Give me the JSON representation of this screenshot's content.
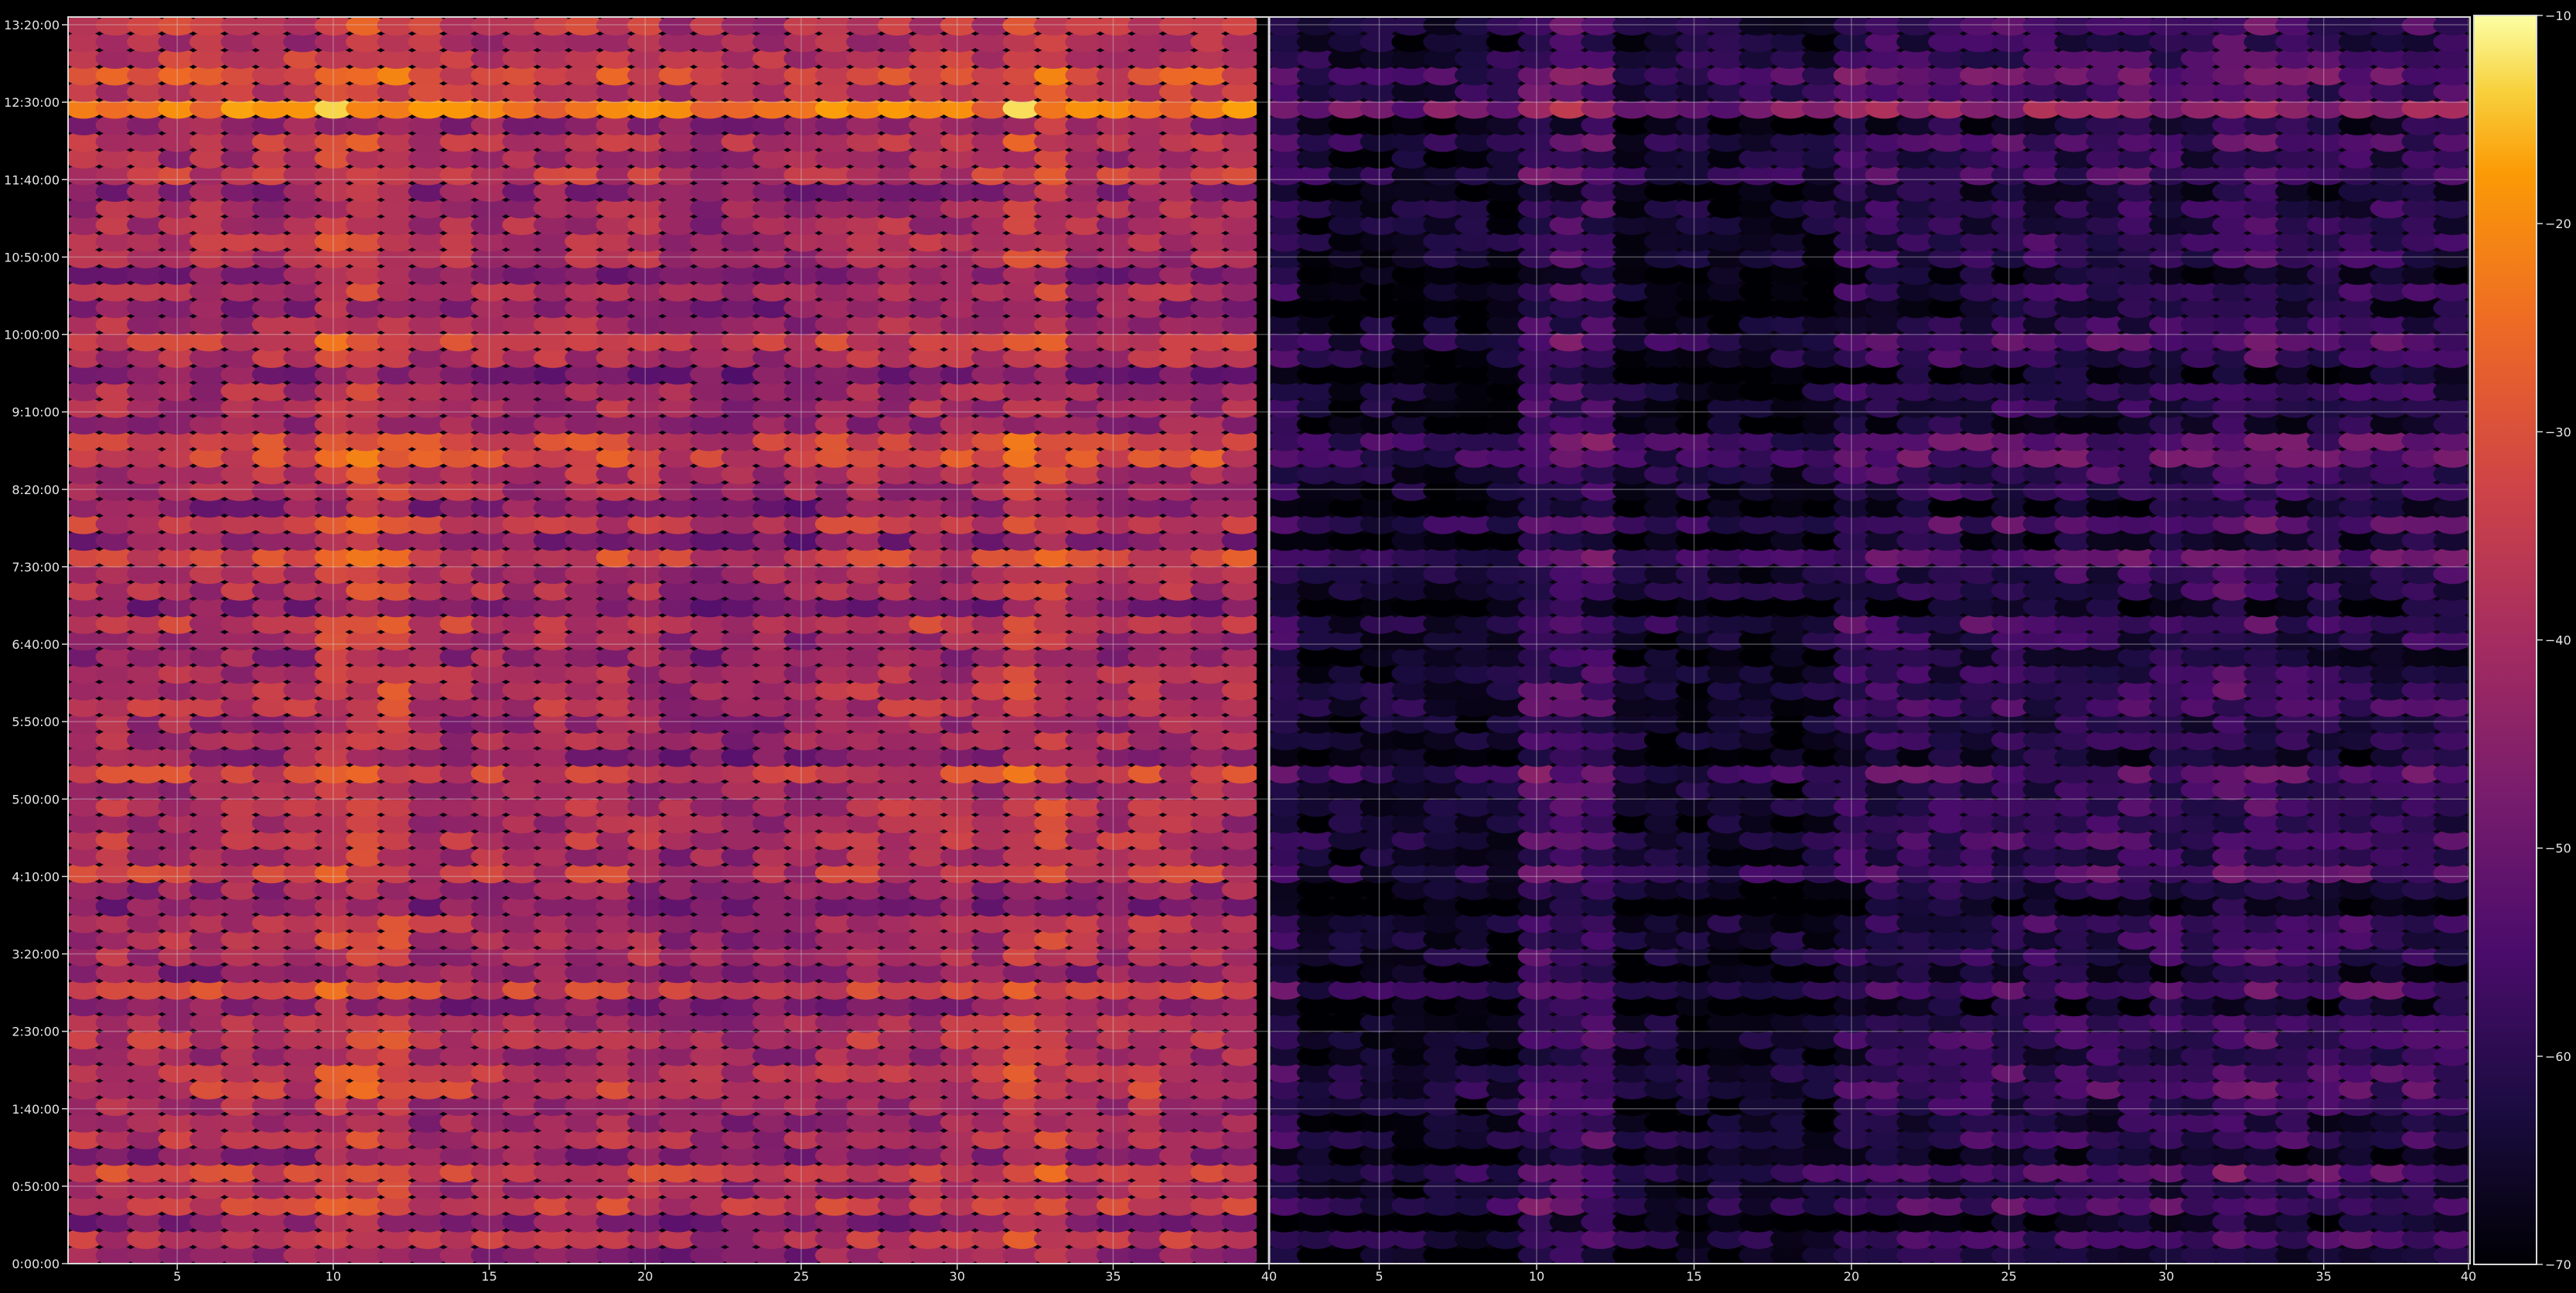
{
  "chart_data": {
    "type": "heatmap",
    "colormap": "inferno",
    "background": "#000000",
    "grid": true,
    "legend": "colorbar-right",
    "colorbar": {
      "range": [
        -70,
        -10
      ],
      "ticks": [
        {
          "value": -10,
          "label": "−10"
        },
        {
          "value": -20,
          "label": "−20"
        },
        {
          "value": -30,
          "label": "−30"
        },
        {
          "value": -40,
          "label": "−40"
        },
        {
          "value": -50,
          "label": "−50"
        },
        {
          "value": -60,
          "label": "−60"
        },
        {
          "value": -70,
          "label": "−70"
        }
      ]
    },
    "y_axis": {
      "range_minutes": [
        0,
        805
      ],
      "ticks": [
        {
          "value": 0,
          "label": "0:00:00"
        },
        {
          "value": 50,
          "label": "0:50:00"
        },
        {
          "value": 100,
          "label": "1:40:00"
        },
        {
          "value": 150,
          "label": "2:30:00"
        },
        {
          "value": 200,
          "label": "3:20:00"
        },
        {
          "value": 250,
          "label": "4:10:00"
        },
        {
          "value": 300,
          "label": "5:00:00"
        },
        {
          "value": 350,
          "label": "5:50:00"
        },
        {
          "value": 400,
          "label": "6:40:00"
        },
        {
          "value": 450,
          "label": "7:30:00"
        },
        {
          "value": 500,
          "label": "8:20:00"
        },
        {
          "value": 550,
          "label": "9:10:00"
        },
        {
          "value": 600,
          "label": "10:00:00"
        },
        {
          "value": 650,
          "label": "10:50:00"
        },
        {
          "value": 700,
          "label": "11:40:00"
        },
        {
          "value": 750,
          "label": "12:30:00"
        },
        {
          "value": 800,
          "label": "13:20:00"
        }
      ]
    },
    "panels": [
      {
        "name": "left",
        "x_range": [
          1.5,
          39.6
        ],
        "x_ticks": [
          {
            "value": 5,
            "label": "5"
          },
          {
            "value": 10,
            "label": "10"
          },
          {
            "value": 15,
            "label": "15"
          },
          {
            "value": 20,
            "label": "20"
          },
          {
            "value": 25,
            "label": "25"
          },
          {
            "value": 30,
            "label": "30"
          },
          {
            "value": 35,
            "label": "35"
          }
        ],
        "level_offset": 0,
        "channels": 38,
        "rows": 75
      },
      {
        "name": "right",
        "x_range": [
          40.0,
          39.6
        ],
        "display_x_range": [
          1.5,
          39.6
        ],
        "x_ticks": [
          {
            "value": 1.5,
            "label": "40"
          },
          {
            "value": 5,
            "label": "5"
          },
          {
            "value": 10,
            "label": "10"
          },
          {
            "value": 15,
            "label": "15"
          },
          {
            "value": 20,
            "label": "20"
          },
          {
            "value": 25,
            "label": "25"
          },
          {
            "value": 30,
            "label": "30"
          },
          {
            "value": 35,
            "label": "35"
          },
          {
            "value": 39.6,
            "label": "40"
          }
        ],
        "level_offset": -20,
        "channels": 38,
        "rows": 75
      }
    ],
    "base_level": -40,
    "bright_rows_minutes": [
      765,
      748,
      745,
      700,
      655,
      598,
      590,
      530,
      520,
      505,
      475,
      455,
      440,
      410,
      375,
      355,
      315,
      300,
      270,
      255,
      215,
      175,
      150,
      140,
      120,
      110,
      85,
      60,
      40,
      20
    ],
    "dark_rows_minutes": [
      792,
      735,
      690,
      640,
      615,
      575,
      545,
      490,
      465,
      425,
      395,
      345,
      325,
      290,
      245,
      230,
      190,
      165,
      130,
      95,
      72,
      28,
      8
    ],
    "bright_columns": [
      9,
      10,
      11,
      31,
      32
    ],
    "dark_columns_right": [
      2,
      3,
      4,
      5,
      6,
      7,
      8,
      12,
      13,
      14,
      15,
      16,
      17,
      18
    ]
  }
}
